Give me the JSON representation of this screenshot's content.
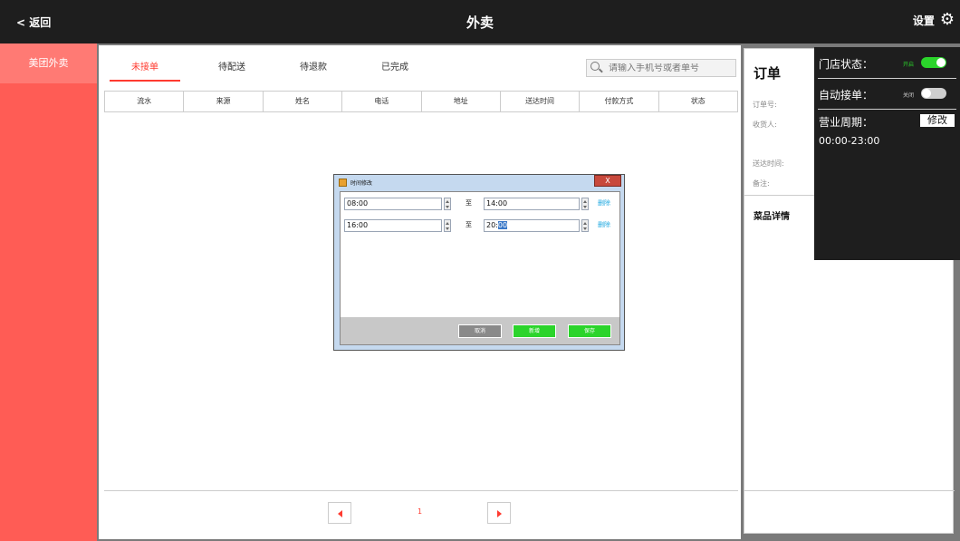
{
  "topbar": {
    "back_label": "< 返回",
    "title": "外卖",
    "settings_label": "设置",
    "settings_icon": "gear-icon"
  },
  "sidebar": {
    "items": [
      {
        "label": "美团外卖"
      }
    ]
  },
  "tabs": [
    {
      "label": "未接单",
      "active": true
    },
    {
      "label": "待配送"
    },
    {
      "label": "待退款"
    },
    {
      "label": "已完成"
    }
  ],
  "search": {
    "placeholder": "请输入手机号或者单号",
    "icon": "search-icon"
  },
  "table": {
    "columns": [
      "流水",
      "来源",
      "姓名",
      "电话",
      "地址",
      "送达时间",
      "付款方式",
      "状态"
    ]
  },
  "pager": {
    "page": "1"
  },
  "order": {
    "title": "订单",
    "fields": [
      "订单号:",
      "收货人:",
      "送达时间:",
      "备注:"
    ],
    "dishes_title": "菜品详情"
  },
  "store_panel": {
    "status_label": "门店状态：",
    "status_toggle": "开启",
    "auto_label": "自动接单：",
    "auto_toggle": "关闭",
    "period_label": "营业周期：",
    "modify_label": "修改",
    "period_value": "00:00-23:00"
  },
  "dialog": {
    "title": "时间修改",
    "close_label": "X",
    "rows": [
      {
        "start": "08:00",
        "sep": "至",
        "end": "14:00",
        "delete": "删除"
      },
      {
        "start": "16:00",
        "sep": "至",
        "end_prefix": "20:",
        "end_selected": "00",
        "delete": "删除"
      }
    ],
    "cancel_label": "取消",
    "add_label": "新增",
    "save_label": "保存"
  },
  "colors": {
    "accent": "#ff3b30",
    "sidebar": "#ff5c55",
    "toggle_on": "#2bd42b",
    "button_green": "#2bd42b",
    "link": "#1fa8e0"
  }
}
